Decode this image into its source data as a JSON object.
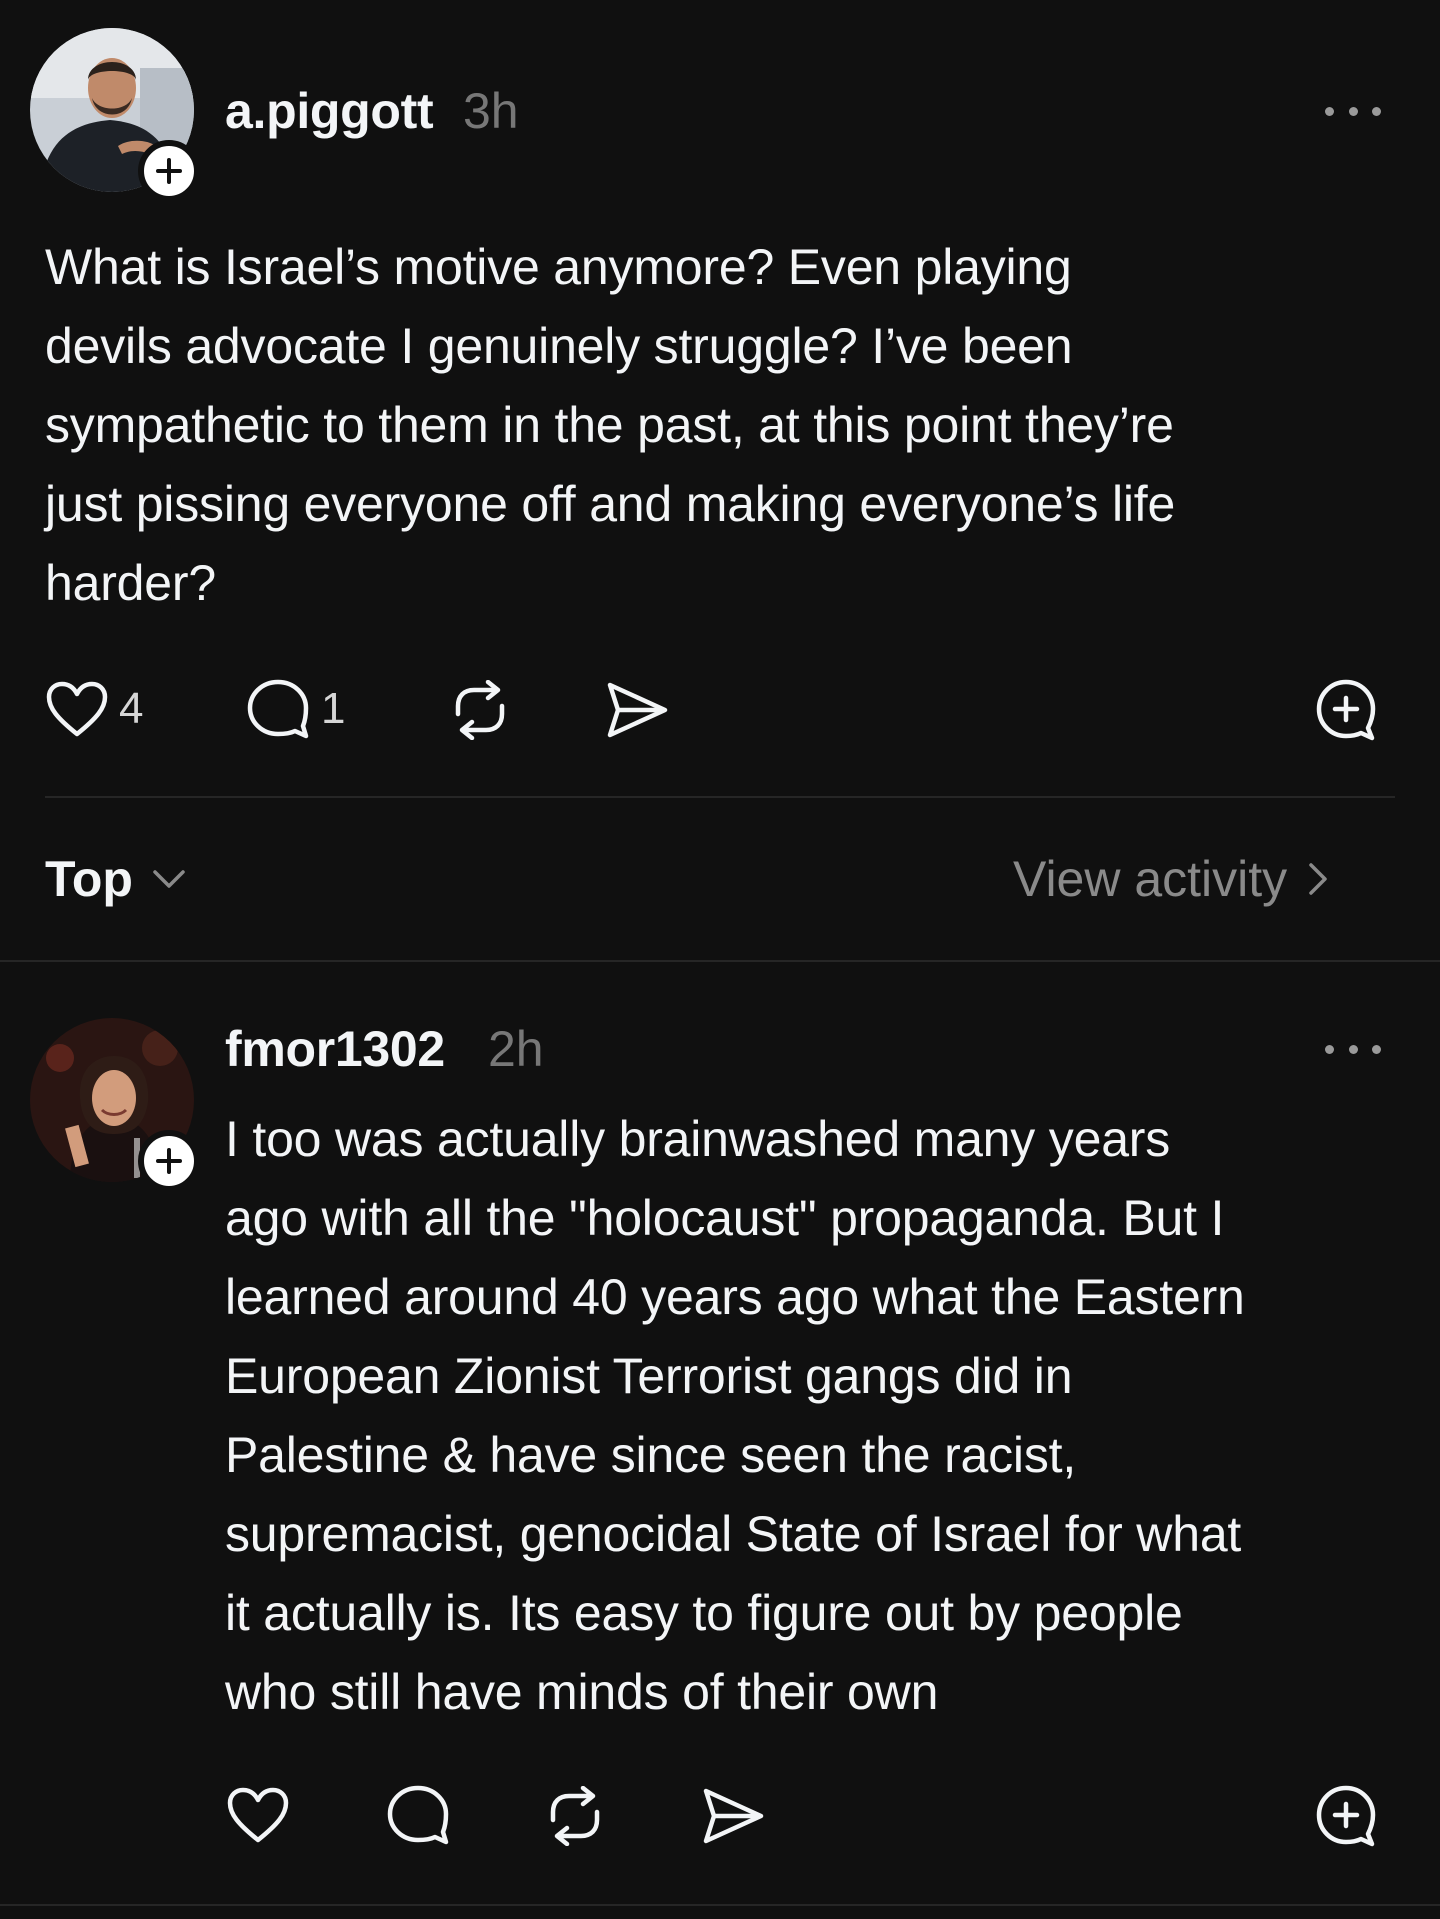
{
  "post": {
    "username": "a.piggott",
    "time": "3h",
    "text": "What is Israel’s motive anymore? Even playing\ndevils advocate I genuinely struggle? I’ve been\nsympathetic to them in the past, at this point they’re\njust pissing everyone off and making everyone’s life\nharder?",
    "likes": "4",
    "replies": "1"
  },
  "replies_bar": {
    "sort_label": "Top",
    "view_activity_label": "View activity"
  },
  "reply": {
    "username": "fmor1302",
    "time": "2h",
    "text": "I too was actually brainwashed many years\nago with all the \"holocaust\" propaganda. But I\nlearned around 40 years ago what the Eastern\nEuropean Zionist Terrorist gangs did in\nPalestine & have since seen the racist,\nsupremacist, genocidal State of Israel for what\nit actually is. Its easy to figure out by people\nwho still have minds of their own"
  },
  "icons": {
    "like": "heart-icon",
    "reply": "speech-bubble-icon",
    "repost": "repost-icon",
    "share": "send-icon",
    "quote": "quote-plus-icon",
    "more": "more-dots-icon",
    "follow": "plus-icon"
  },
  "colors": {
    "background": "#101010",
    "text": "#f3f5f7",
    "muted": "#777777",
    "divider": "#262626"
  }
}
